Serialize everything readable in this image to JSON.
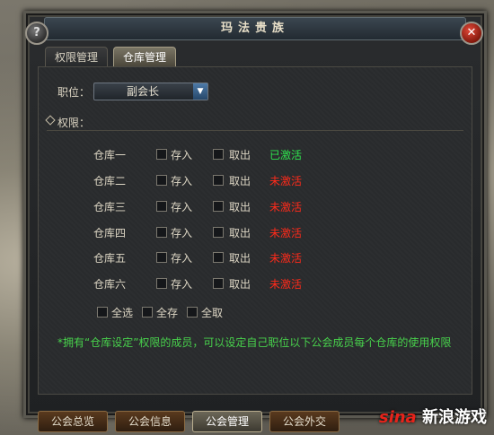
{
  "window": {
    "title": "玛法贵族"
  },
  "tabs": [
    {
      "label": "权限管理",
      "active": false
    },
    {
      "label": "仓库管理",
      "active": true
    }
  ],
  "position_field": {
    "label": "职位：",
    "selected": "副会长"
  },
  "permissions": {
    "label": "权限："
  },
  "warehouses": [
    {
      "name": "仓库一",
      "deposit_label": "存入",
      "withdraw_label": "取出",
      "status": "已激活",
      "active": true
    },
    {
      "name": "仓库二",
      "deposit_label": "存入",
      "withdraw_label": "取出",
      "status": "未激活",
      "active": false
    },
    {
      "name": "仓库三",
      "deposit_label": "存入",
      "withdraw_label": "取出",
      "status": "未激活",
      "active": false
    },
    {
      "name": "仓库四",
      "deposit_label": "存入",
      "withdraw_label": "取出",
      "status": "未激活",
      "active": false
    },
    {
      "name": "仓库五",
      "deposit_label": "存入",
      "withdraw_label": "取出",
      "status": "未激活",
      "active": false
    },
    {
      "name": "仓库六",
      "deposit_label": "存入",
      "withdraw_label": "取出",
      "status": "未激活",
      "active": false
    }
  ],
  "bulk_options": {
    "select_all": "全选",
    "deposit_all": "全存",
    "withdraw_all": "全取"
  },
  "note": "*拥有“仓库设定”权限的成员，可以设定自己职位以下公会成员每个仓库的使用权限",
  "bottom_tabs": [
    {
      "label": "公会总览",
      "active": false
    },
    {
      "label": "公会信息",
      "active": false
    },
    {
      "label": "公会管理",
      "active": true
    },
    {
      "label": "公会外交",
      "active": false
    }
  ],
  "watermark": {
    "logo": "sina",
    "text": "新浪游戏"
  },
  "colors": {
    "active_status": "#2ee34d",
    "inactive_status": "#ff2a1a",
    "note_text": "#48d24c"
  }
}
